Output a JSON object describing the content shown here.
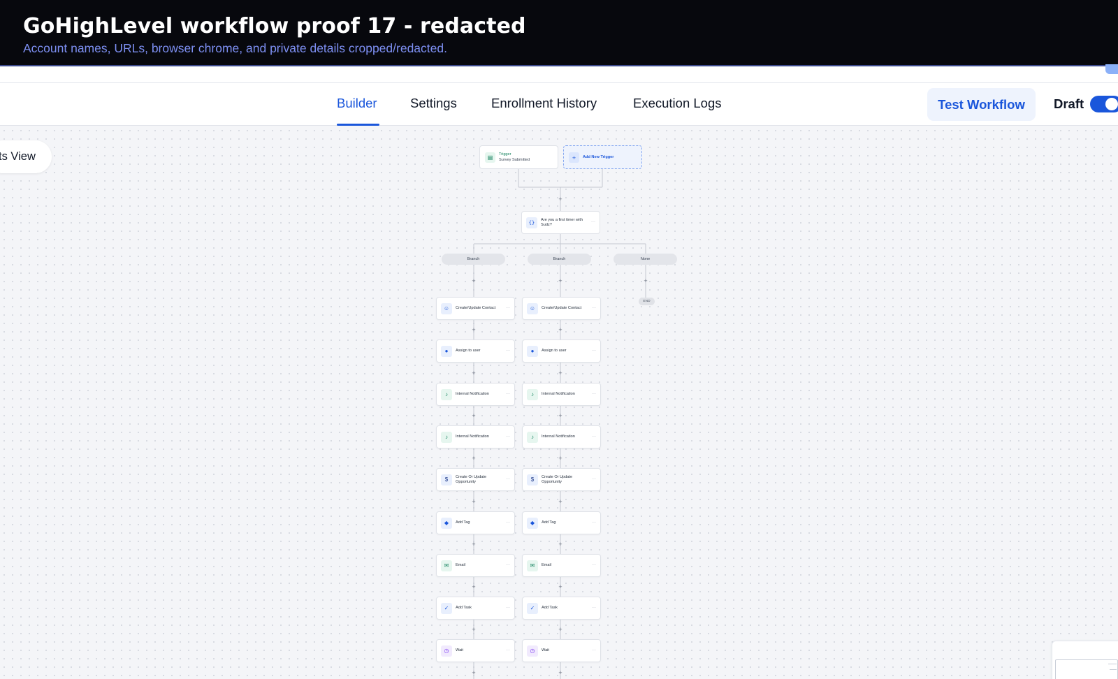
{
  "banner": {
    "title": "GoHighLevel workflow proof 17 - redacted",
    "subtitle": "Account names, URLs, browser chrome, and private details cropped/redacted."
  },
  "nav": {
    "tabs": [
      {
        "label": "Builder",
        "active": true
      },
      {
        "label": "Settings",
        "active": false
      },
      {
        "label": "Enrollment History",
        "active": false
      },
      {
        "label": "Execution Logs",
        "active": false
      }
    ],
    "test_button": "Test Workflow",
    "status_label": "Draft",
    "status_toggle_on": true
  },
  "canvas": {
    "view_button": "ts View",
    "trigger": {
      "label": "Trigger",
      "name": "Survey Submitted",
      "icon": "clipboard-icon"
    },
    "add_trigger": {
      "label": "Add New Trigger",
      "icon": "plus-icon"
    },
    "condition": {
      "label": "Are you a first timer with Sudz?",
      "icon": "code-braces-icon"
    },
    "branches": [
      "Branch",
      "Branch",
      "None"
    ],
    "end_label": "END",
    "actions": [
      {
        "label": "Create/Update Contact",
        "icon": "users-icon",
        "color": "#1a56db"
      },
      {
        "label": "Assign to user",
        "icon": "user-icon",
        "color": "#1a56db"
      },
      {
        "label": "Internal Notification",
        "icon": "bell-icon",
        "color": "#12805c"
      },
      {
        "label": "Internal Notification",
        "icon": "bell-icon",
        "color": "#12805c"
      },
      {
        "label": "Create Or Update Opportunity",
        "icon": "dollar-icon",
        "color": "#1e3a8a"
      },
      {
        "label": "Add Tag",
        "icon": "tag-icon",
        "color": "#1a56db"
      },
      {
        "label": "Email",
        "icon": "mail-icon",
        "color": "#12805c"
      },
      {
        "label": "Add Task",
        "icon": "task-check-icon",
        "color": "#1a56db"
      },
      {
        "label": "Wait",
        "icon": "clock-icon",
        "color": "#7e3af2"
      }
    ],
    "colors": {
      "accent": "#1a56db",
      "green": "#12805c",
      "purple": "#7e3af2"
    }
  }
}
